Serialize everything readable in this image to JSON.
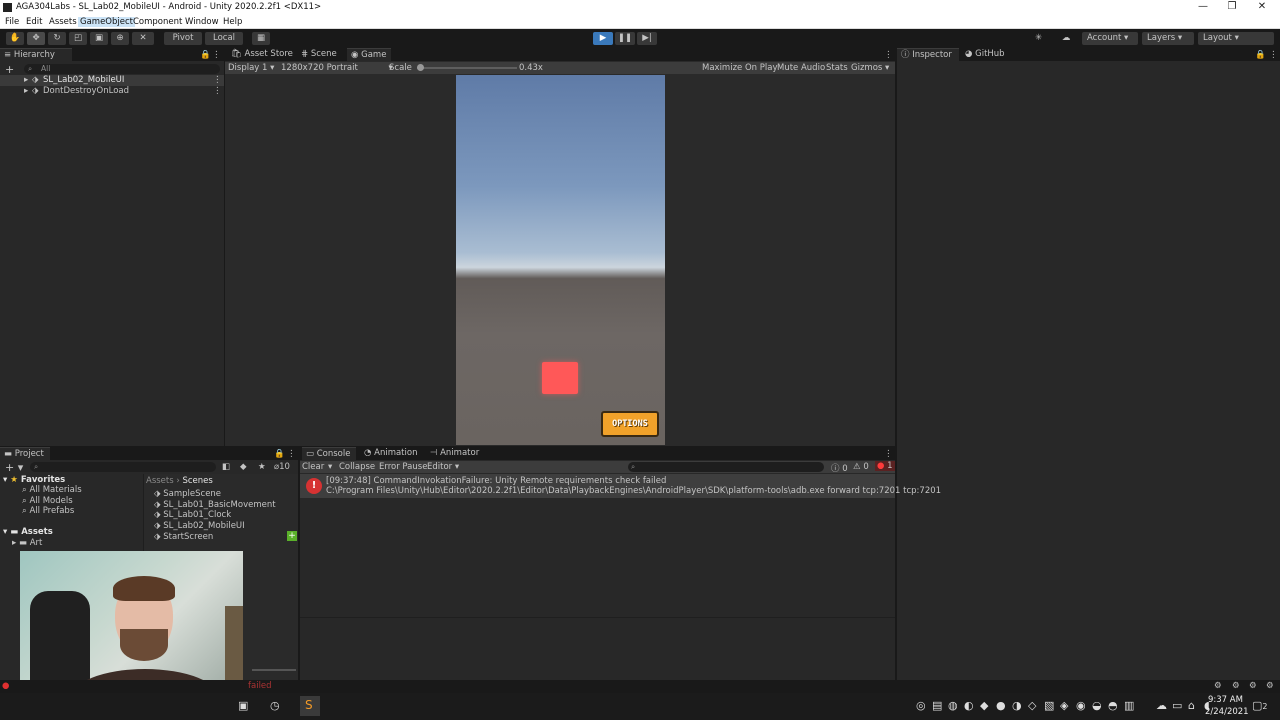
{
  "window": {
    "title": "AGA304Labs - SL_Lab02_MobileUI - Android - Unity 2020.2.2f1 <DX11>",
    "min": "—",
    "max": "❐",
    "close": "✕"
  },
  "menu": [
    "File",
    "Edit",
    "Assets",
    "GameObject",
    "Component",
    "Window",
    "Help"
  ],
  "toolbar": {
    "pivot": "Pivot",
    "local": "Local",
    "account": "Account",
    "layers": "Layers",
    "layout": "Layout"
  },
  "hierarchy": {
    "tab": "Hierarchy",
    "search": "All",
    "items": [
      "SL_Lab02_MobileUI",
      "DontDestroyOnLoad"
    ]
  },
  "center_tabs": [
    "Asset Store",
    "Scene",
    "Game"
  ],
  "gamebar": {
    "display": "Display 1",
    "resolution": "1280x720 Portrait",
    "scale_label": "Scale",
    "scale_value": "0.43x",
    "maximize": "Maximize On Play",
    "mute": "Mute Audio",
    "stats": "Stats",
    "gizmos": "Gizmos"
  },
  "game": {
    "options_button": "OPTIONS"
  },
  "right_tabs": [
    "Inspector",
    "GitHub"
  ],
  "project": {
    "tab": "Project",
    "count": "10",
    "favorites_label": "Favorites",
    "favorites": [
      "All Materials",
      "All Models",
      "All Prefabs"
    ],
    "assets_label": "Assets",
    "assets_children": [
      "Art"
    ],
    "breadcrumb_root": "Assets",
    "breadcrumb_current": "Scenes",
    "files": [
      "SampleScene",
      "SL_Lab01_BasicMovement",
      "SL_Lab01_Clock",
      "SL_Lab02_MobileUI",
      "StartScreen"
    ]
  },
  "console": {
    "tabs": [
      "Console",
      "Animation",
      "Animator"
    ],
    "clear": "Clear",
    "collapse": "Collapse",
    "error_pause": "Error Pause",
    "editor": "Editor",
    "info_count": "0",
    "warn_count": "0",
    "error_count": "1",
    "message_line1": "[09:37:48] CommandInvokationFailure: Unity Remote requirements check failed",
    "message_line2": "C:\\Program Files\\Unity\\Hub\\Editor\\2020.2.2f1\\Editor\\Data\\PlaybackEngines\\AndroidPlayer\\SDK\\platform-tools\\adb.exe forward tcp:7201 tcp:7201"
  },
  "status": {
    "error_text": "failed"
  },
  "taskbar": {
    "time": "9:37 AM",
    "date": "2/24/2021",
    "notif": "2"
  }
}
